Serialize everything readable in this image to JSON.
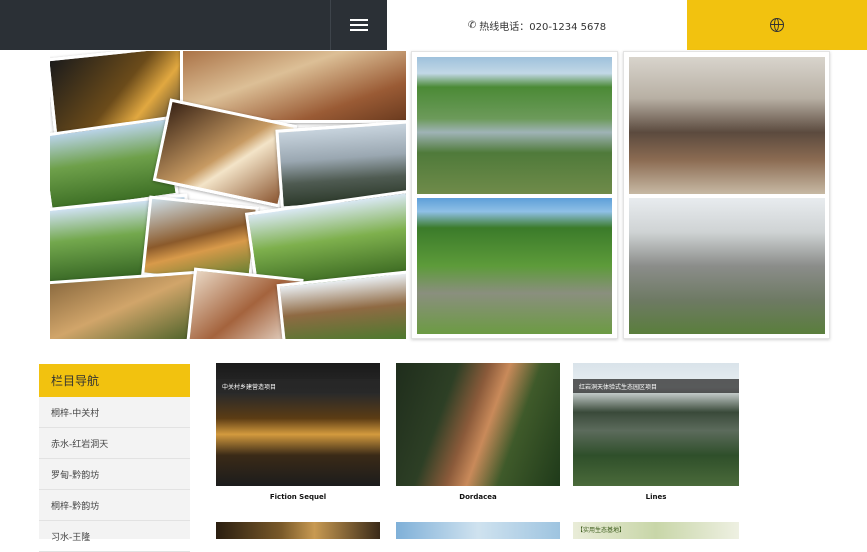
{
  "header": {
    "menu_icon": "hamburger-icon",
    "hotline": "热线电话：020-1234 5678",
    "phone_icon": "phone-icon",
    "lang_icon": "globe-icon",
    "accent_color": "#f2c20f",
    "dark_color": "#2b3036"
  },
  "sidebar": {
    "title": "栏目导航",
    "items": [
      {
        "label": "桐梓-中关村"
      },
      {
        "label": "赤水-红岩洞天"
      },
      {
        "label": "罗甸-黔韵坊"
      },
      {
        "label": "桐梓-黔韵坊"
      },
      {
        "label": "习水-王隆"
      }
    ]
  },
  "projects": [
    {
      "caption": "中关村乡建营造项目",
      "label": "Fiction Sequel"
    },
    {
      "caption": "",
      "label": "Dordacea"
    },
    {
      "caption": "红岩洞天体验式生态园区项目",
      "label": "Lines"
    },
    {
      "caption": "",
      "label": ""
    },
    {
      "caption": "",
      "label": ""
    },
    {
      "caption": "【实用生态基地】",
      "label": ""
    }
  ]
}
